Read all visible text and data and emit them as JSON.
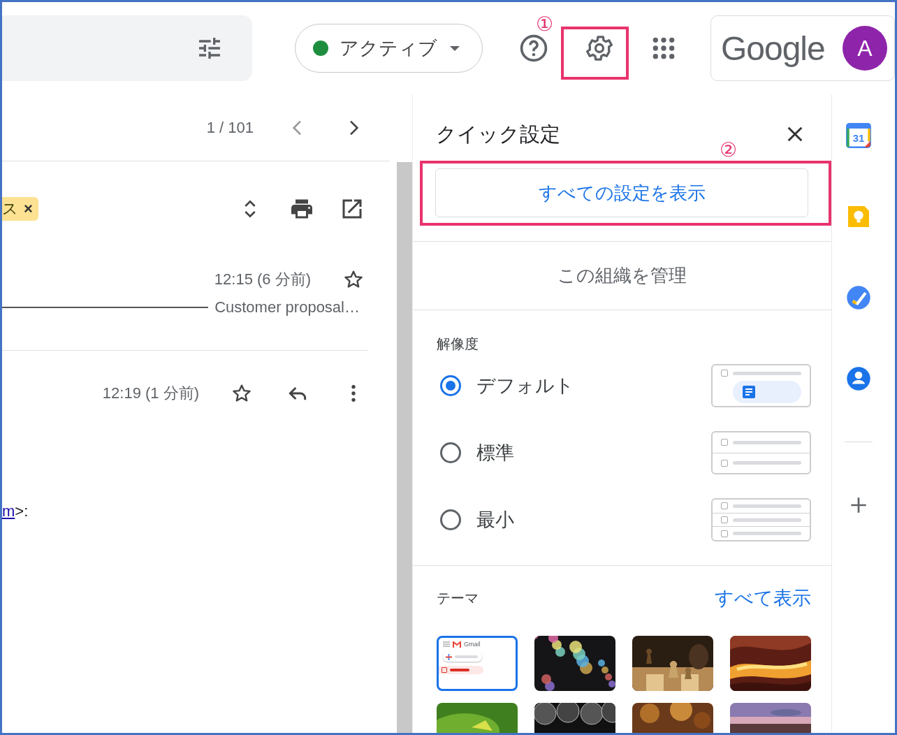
{
  "status": {
    "label": "アクティブ"
  },
  "account": {
    "logo": "Google",
    "avatar": "A"
  },
  "annotations": [
    {
      "label": "①"
    },
    {
      "label": "②"
    }
  ],
  "conversation": {
    "position": "1 / 101",
    "chip": {
      "label": "ス",
      "close": "×"
    },
    "messages": [
      {
        "time": "12:15 (6 分前)",
        "snippet": "Customer proposal…",
        "starred": false
      },
      {
        "time": "12:19 (1 分前)",
        "starred": false
      }
    ],
    "body_link": "m",
    "body_text": ">:"
  },
  "quick_settings": {
    "title": "クイック設定",
    "all_settings_button": "すべての設定を表示",
    "manage_org": "この組織を管理",
    "density_heading": "解像度",
    "density_options": [
      {
        "label": "デフォルト",
        "kind": "default",
        "selected": true
      },
      {
        "label": "標準",
        "kind": "comfortable",
        "selected": false
      },
      {
        "label": "最小",
        "kind": "compact",
        "selected": false
      }
    ],
    "theme_heading": "テーマ",
    "theme_link": "すべて表示",
    "themes": [
      {
        "kind": "default",
        "label": "Gmail",
        "selected": true
      },
      {
        "kind": "bokeh",
        "selected": false
      },
      {
        "kind": "chess",
        "selected": false
      },
      {
        "kind": "canyon",
        "selected": false
      },
      {
        "kind": "leaf",
        "selected": false
      },
      {
        "kind": "pipes",
        "selected": false
      },
      {
        "kind": "autumn",
        "selected": false
      },
      {
        "kind": "sunset",
        "selected": false
      }
    ]
  },
  "side_apps": {
    "calendar_day": "31"
  }
}
